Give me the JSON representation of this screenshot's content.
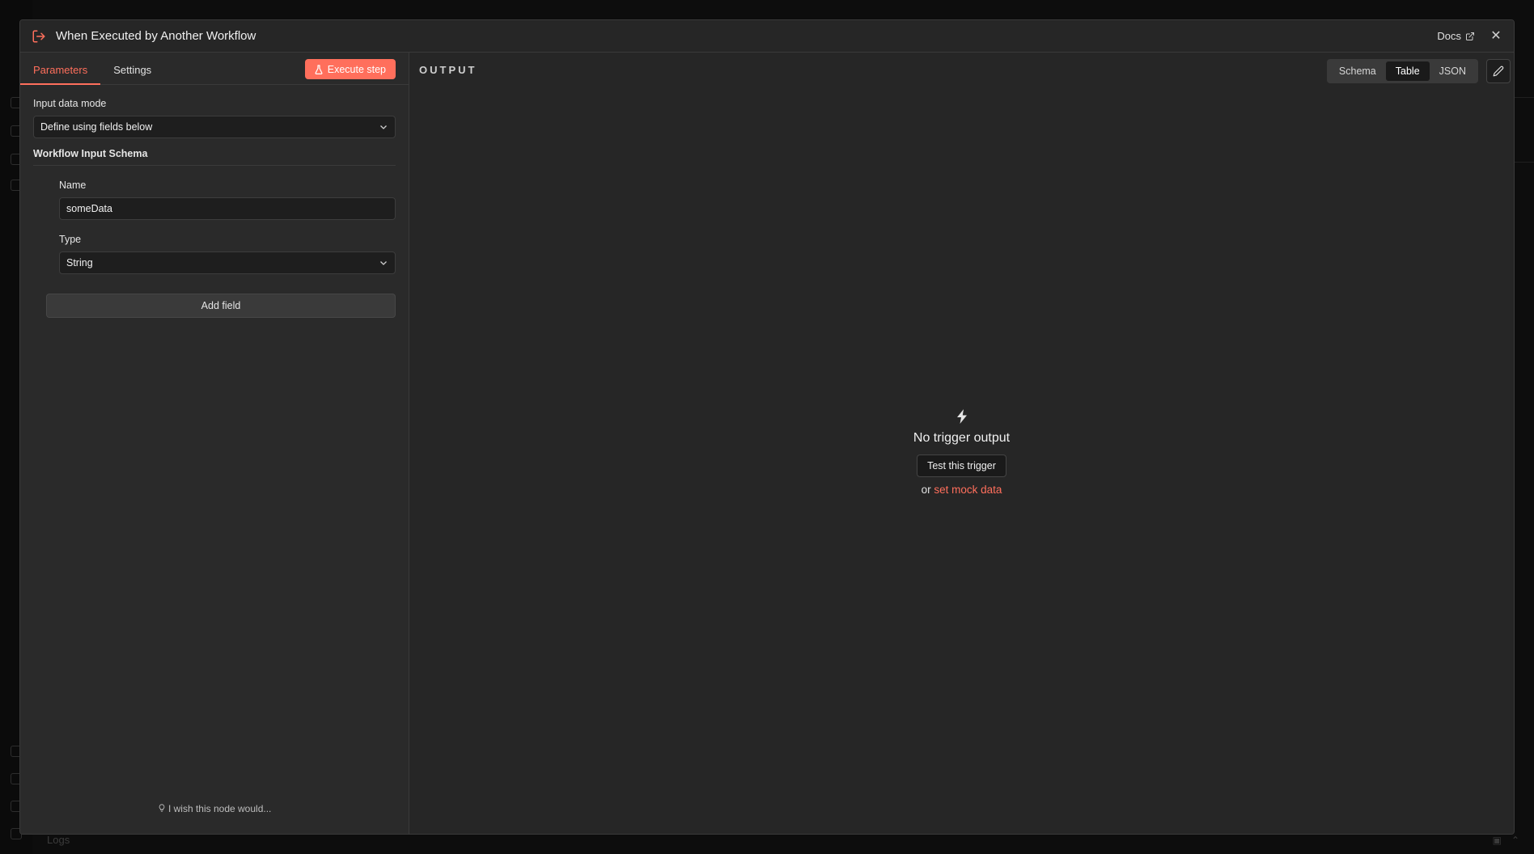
{
  "background": {
    "logs_label": "Logs"
  },
  "modal": {
    "title": "When Executed by Another Workflow",
    "docs_label": "Docs",
    "close_label": "✕"
  },
  "left": {
    "tabs": [
      {
        "label": "Parameters",
        "active": true
      },
      {
        "label": "Settings",
        "active": false
      }
    ],
    "execute_label": "Execute step",
    "input_mode_label": "Input data mode",
    "input_mode_value": "Define using fields below",
    "schema_title": "Workflow Input Schema",
    "field_name_label": "Name",
    "field_name_value": "someData",
    "field_type_label": "Type",
    "field_type_value": "String",
    "add_field_label": "Add field",
    "feedback_label": "I wish this node would..."
  },
  "right": {
    "output_label": "OUTPUT",
    "views": [
      {
        "label": "Schema",
        "active": false
      },
      {
        "label": "Table",
        "active": true
      },
      {
        "label": "JSON",
        "active": false
      }
    ],
    "empty_title": "No trigger output",
    "test_button_label": "Test this trigger",
    "mock_prefix": "or",
    "mock_link_label": "set mock data"
  },
  "colors": {
    "accent": "#ff6f5c",
    "panel": "#2a2a2a",
    "background": "#262626"
  }
}
